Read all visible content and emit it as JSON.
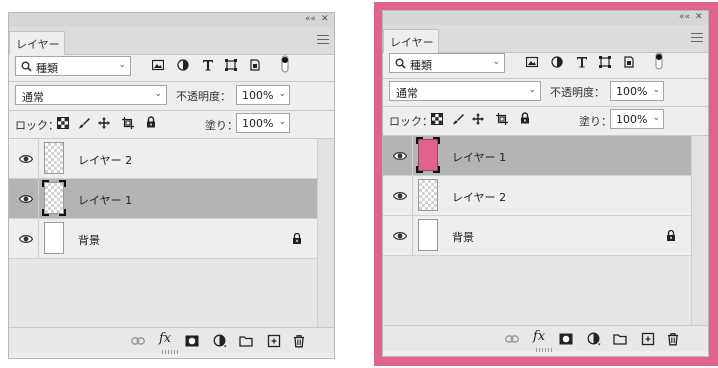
{
  "panel_left": {
    "title_tab": "レイヤー",
    "collapse_glyph": "««",
    "close_glyph": "✕",
    "filter": {
      "value": "種類"
    },
    "blend_mode": "通常",
    "opacity_label": "不透明度：",
    "opacity_value": "100%",
    "lock_label": "ロック：",
    "fill_label": "塗り：",
    "fill_value": "100%",
    "layers": [
      {
        "name": "レイヤー 2",
        "thumb": "transparent",
        "selected": false,
        "locked": false
      },
      {
        "name": "レイヤー 1",
        "thumb": "transparent",
        "selected": true,
        "locked": false
      },
      {
        "name": "背景",
        "thumb": "white",
        "selected": false,
        "locked": true
      }
    ]
  },
  "panel_right": {
    "title_tab": "レイヤー",
    "collapse_glyph": "««",
    "close_glyph": "✕",
    "filter": {
      "value": "種類"
    },
    "blend_mode": "通常",
    "opacity_label": "不透明度：",
    "opacity_value": "100%",
    "lock_label": "ロック：",
    "fill_label": "塗り：",
    "fill_value": "100%",
    "layers": [
      {
        "name": "レイヤー 1",
        "thumb": "pink",
        "selected": true,
        "locked": false
      },
      {
        "name": "レイヤー 2",
        "thumb": "transparent",
        "selected": false,
        "locked": false
      },
      {
        "name": "背景",
        "thumb": "white",
        "selected": false,
        "locked": true
      }
    ]
  },
  "colors": {
    "highlight_frame": "#e2628f",
    "panel_bg": "#eeeeee",
    "selected_row": "#b4b4b4"
  },
  "icons": {
    "filter_icons": [
      "image-filter-icon",
      "adjustment-filter-icon",
      "type-filter-icon",
      "shape-filter-icon",
      "smart-object-filter-icon",
      "filter-toggle-icon"
    ],
    "lock_icons": [
      "lock-transparency-icon",
      "lock-pixels-icon",
      "lock-position-icon",
      "lock-artboard-icon",
      "lock-all-icon"
    ],
    "bottom_icons": [
      "link-layers-icon",
      "fx-icon",
      "mask-icon",
      "adjustment-layer-icon",
      "group-folder-icon",
      "new-layer-icon",
      "trash-icon"
    ],
    "fx_text": "fx"
  }
}
